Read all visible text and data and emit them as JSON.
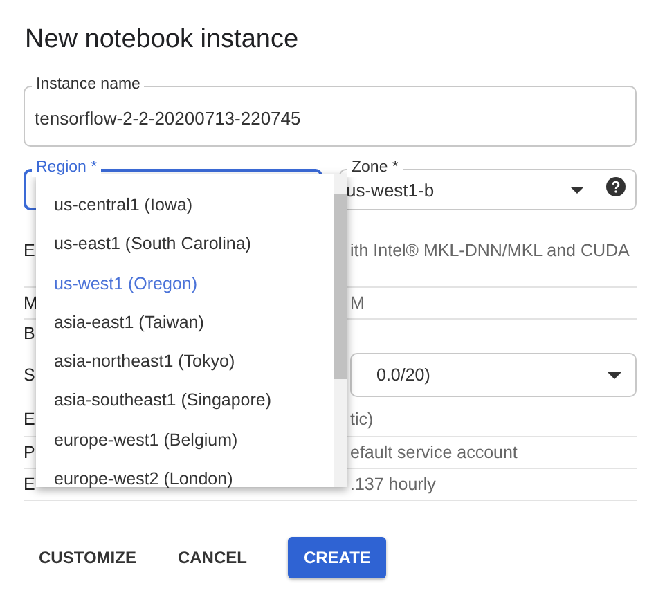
{
  "title": "New notebook instance",
  "instance_name": {
    "label": "Instance name",
    "value": "tensorflow-2-2-20200713-220745"
  },
  "region": {
    "label": "Region *",
    "focused": true
  },
  "zone": {
    "label": "Zone *",
    "value": "us-west1-b"
  },
  "rows": [
    {
      "kind": "text",
      "label": "E",
      "value": "ith Intel® MKL-DNN/MKL and CUDA"
    },
    {
      "kind": "text",
      "label": "M",
      "value": "M"
    },
    {
      "kind": "text",
      "label": "B",
      "value": ""
    },
    {
      "kind": "select",
      "label": "S",
      "value": "0.0/20)"
    },
    {
      "kind": "text",
      "label": "E",
      "value": "tic)"
    },
    {
      "kind": "text",
      "label": "P",
      "value": "efault service account"
    },
    {
      "kind": "text",
      "label": "E",
      "value": ".137 hourly"
    }
  ],
  "region_menu": [
    {
      "label": "us-central1 (Iowa)",
      "selected": false
    },
    {
      "label": "us-east1 (South Carolina)",
      "selected": false
    },
    {
      "label": "us-west1 (Oregon)",
      "selected": true
    },
    {
      "label": "asia-east1 (Taiwan)",
      "selected": false
    },
    {
      "label": "asia-northeast1 (Tokyo)",
      "selected": false
    },
    {
      "label": "asia-southeast1 (Singapore)",
      "selected": false
    },
    {
      "label": "europe-west1 (Belgium)",
      "selected": false
    },
    {
      "label": "europe-west2 (London)",
      "selected": false
    }
  ],
  "buttons": [
    {
      "label": "CUSTOMIZE",
      "kind": "text"
    },
    {
      "label": "CANCEL",
      "kind": "text"
    },
    {
      "label": "CREATE",
      "kind": "primary"
    }
  ]
}
